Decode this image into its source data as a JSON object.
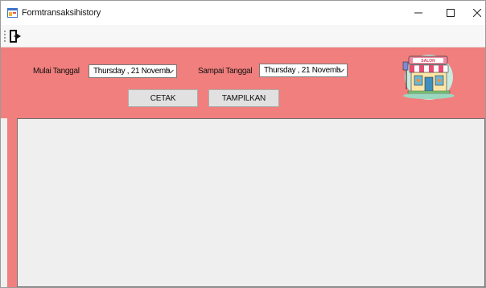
{
  "window": {
    "title": "Formtransaksihistory",
    "minimize_symbol": "—",
    "maximize_symbol": "☐",
    "close_symbol": "✕"
  },
  "toolbar": {
    "exit_icon": "exit-door-icon"
  },
  "filters": {
    "start_label": "Mulai Tanggal",
    "start_value": "Thursday  , 21 Novemb",
    "end_label": "Sampai Tanggal",
    "end_value": "Thursday  , 21 Novemb"
  },
  "buttons": {
    "print_label": "CETAK",
    "show_label": "TAMPILKAN"
  },
  "logo": {
    "sign_text": "SALON",
    "icon": "salon-storefront-icon"
  },
  "colors": {
    "panel_background": "#f07f7d",
    "grid_background": "#efefef"
  }
}
